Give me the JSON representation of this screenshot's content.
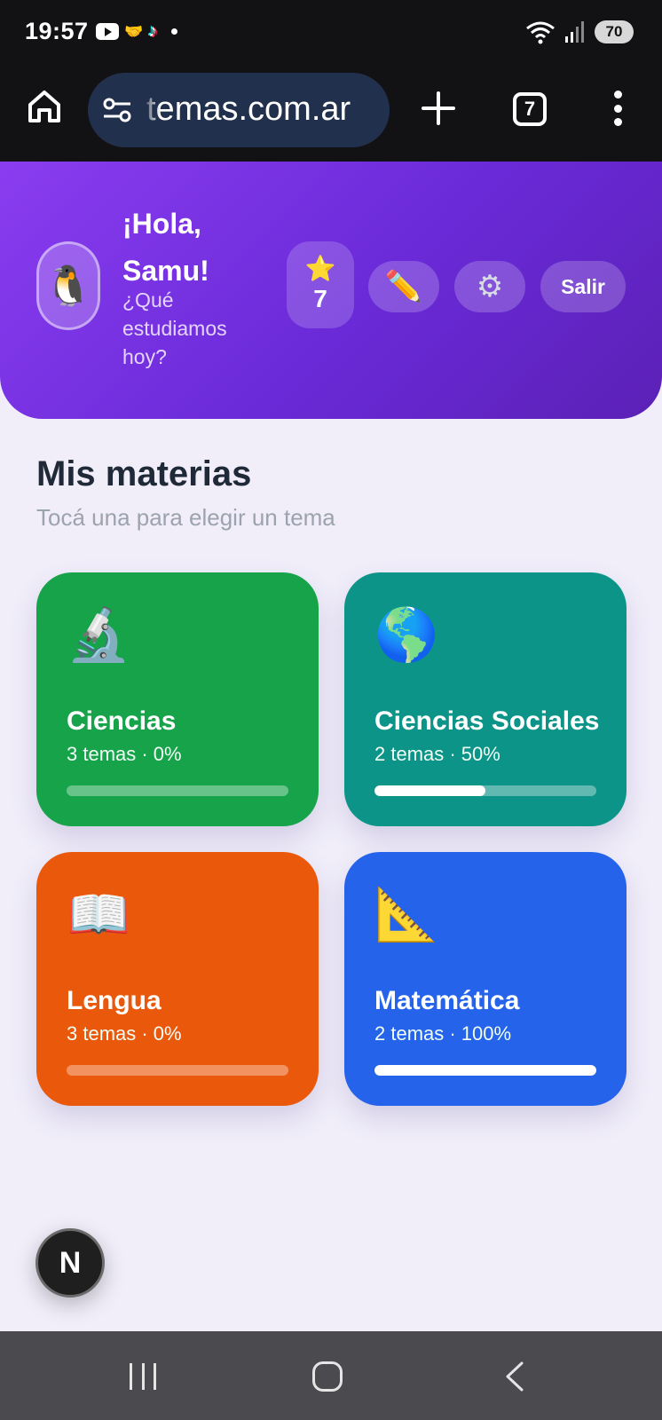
{
  "status_bar": {
    "time": "19:57",
    "battery": "70",
    "icons": [
      "youtube-icon",
      "handshake-icon",
      "tiktok-icon",
      "notification-dot-icon",
      "wifi-icon",
      "signal-icon",
      "battery-icon"
    ]
  },
  "browser": {
    "url": "temas.com.ar",
    "tab_count": "7"
  },
  "header": {
    "avatar": "🐧",
    "greeting": "¡Hola, Samu!",
    "subtitle": "¿Qué estudiamos hoy?",
    "stars_icon": "⭐",
    "stars": "7",
    "edit_icon": "✏️",
    "settings_icon": "⚙",
    "logout_label": "Salir",
    "colors": {
      "gradient_start": "#8a3df0",
      "gradient_end": "#5b21b6"
    }
  },
  "main": {
    "title": "Mis materias",
    "subtitle": "Tocá una para elegir un tema",
    "subjects": [
      {
        "icon": "🔬",
        "name": "Ciencias",
        "meta": "3 temas · 0%",
        "progress": 0,
        "color": "#16a34a"
      },
      {
        "icon": "🌎",
        "name": "Ciencias Sociales",
        "meta": "2 temas · 50%",
        "progress": 0.5,
        "color": "#0d9488"
      },
      {
        "icon": "📖",
        "name": "Lengua",
        "meta": "3 temas · 0%",
        "progress": 0,
        "color": "#ea580c"
      },
      {
        "icon": "📐",
        "name": "Matemática",
        "meta": "2 temas · 100%",
        "progress": 1,
        "color": "#2563eb"
      }
    ]
  },
  "fab": {
    "label": "N"
  }
}
